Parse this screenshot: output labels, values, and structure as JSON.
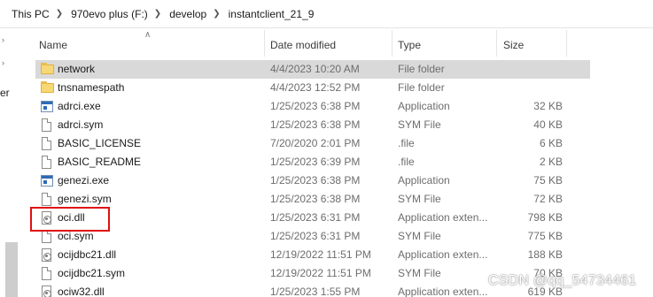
{
  "breadcrumb": [
    "This PC",
    "970evo plus (F:)",
    "develop",
    "instantclient_21_9"
  ],
  "nav_letter": "er",
  "columns": {
    "name": "Name",
    "date": "Date modified",
    "type": "Type",
    "size": "Size"
  },
  "files": [
    {
      "name": "network",
      "date": "4/4/2023 10:20 AM",
      "type": "File folder",
      "size": "",
      "icon": "folder-icon",
      "selected": true
    },
    {
      "name": "tnsnamespath",
      "date": "4/4/2023 12:52 PM",
      "type": "File folder",
      "size": "",
      "icon": "folder-icon"
    },
    {
      "name": "adrci.exe",
      "date": "1/25/2023 6:38 PM",
      "type": "Application",
      "size": "32 KB",
      "icon": "application-icon"
    },
    {
      "name": "adrci.sym",
      "date": "1/25/2023 6:38 PM",
      "type": "SYM File",
      "size": "40 KB",
      "icon": "file-icon"
    },
    {
      "name": "BASIC_LICENSE",
      "date": "7/20/2020 2:01 PM",
      "type": ".file",
      "size": "6 KB",
      "icon": "file-icon"
    },
    {
      "name": "BASIC_README",
      "date": "1/25/2023 6:39 PM",
      "type": ".file",
      "size": "2 KB",
      "icon": "file-icon"
    },
    {
      "name": "genezi.exe",
      "date": "1/25/2023 6:38 PM",
      "type": "Application",
      "size": "75 KB",
      "icon": "application-icon"
    },
    {
      "name": "genezi.sym",
      "date": "1/25/2023 6:38 PM",
      "type": "SYM File",
      "size": "72 KB",
      "icon": "file-icon"
    },
    {
      "name": "oci.dll",
      "date": "1/25/2023 6:31 PM",
      "type": "Application exten...",
      "size": "798 KB",
      "icon": "dll-icon",
      "highlighted": true
    },
    {
      "name": "oci.sym",
      "date": "1/25/2023 6:31 PM",
      "type": "SYM File",
      "size": "775 KB",
      "icon": "file-icon"
    },
    {
      "name": "ocijdbc21.dll",
      "date": "12/19/2022 11:51 PM",
      "type": "Application exten...",
      "size": "188 KB",
      "icon": "dll-icon"
    },
    {
      "name": "ocijdbc21.sym",
      "date": "12/19/2022 11:51 PM",
      "type": "SYM File",
      "size": "70 KB",
      "icon": "file-icon"
    },
    {
      "name": "ociw32.dll",
      "date": "1/25/2023 1:55 PM",
      "type": "Application exten...",
      "size": "619 KB",
      "icon": "dll-icon"
    }
  ],
  "watermark": "CSDN @qq_54734461"
}
